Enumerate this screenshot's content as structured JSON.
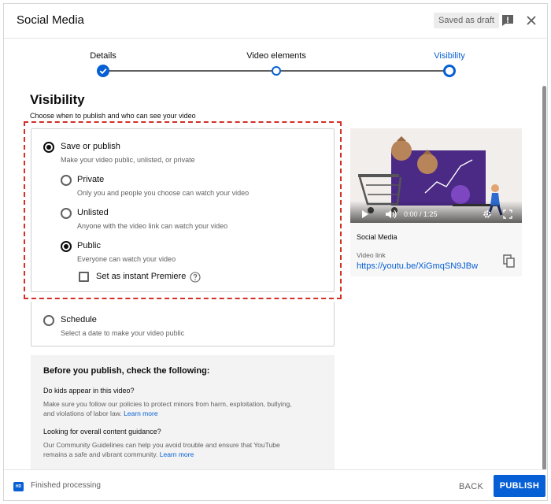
{
  "header": {
    "title": "Social Media",
    "draft_badge": "Saved as draft"
  },
  "stepper": {
    "steps": [
      {
        "label": "Details",
        "state": "done"
      },
      {
        "label": "Video elements",
        "state": "done"
      },
      {
        "label": "Visibility",
        "state": "active"
      }
    ]
  },
  "visibility": {
    "title": "Visibility",
    "subtitle": "Choose when to publish and who can see your video",
    "save_or_publish": {
      "label": "Save or publish",
      "desc": "Make your video public, unlisted, or private",
      "selected": true
    },
    "options": [
      {
        "label": "Private",
        "desc": "Only you and people you choose can watch your video",
        "selected": false
      },
      {
        "label": "Unlisted",
        "desc": "Anyone with the video link can watch your video",
        "selected": false
      },
      {
        "label": "Public",
        "desc": "Everyone can watch your video",
        "selected": true
      }
    ],
    "premiere_label": "Set as instant Premiere",
    "premiere_checked": false,
    "schedule": {
      "label": "Schedule",
      "desc": "Select a date to make your video public",
      "selected": false
    }
  },
  "info": {
    "title": "Before you publish, check the following:",
    "q1": "Do kids appear in this video?",
    "q1_text": "Make sure you follow our policies to protect minors from harm, exploitation, bullying, and violations of labor law.",
    "q1_link": "Learn more",
    "q2": "Looking for overall content guidance?",
    "q2_text": "Our Community Guidelines can help you avoid trouble and ensure that YouTube remains a safe and vibrant community.",
    "q2_link": "Learn more"
  },
  "video": {
    "time": "0:00 / 1:25",
    "name": "Social Media",
    "link_label": "Video link",
    "link": "https://youtu.be/XiGmqSN9JBw"
  },
  "footer": {
    "hd_badge": "HD",
    "status": "Finished processing",
    "back_label": "BACK",
    "publish_label": "PUBLISH"
  },
  "colors": {
    "accent": "#065fd4",
    "highlight": "#d22f27"
  }
}
